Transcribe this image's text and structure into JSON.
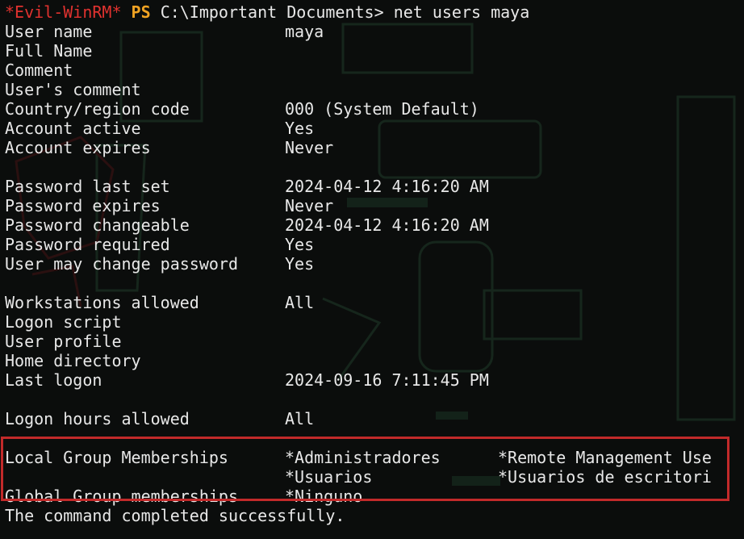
{
  "prompt": {
    "shell_tag": "*Evil-WinRM*",
    "ps": "PS",
    "path": "C:\\Important Documents>",
    "command": "net users maya"
  },
  "rows": [
    {
      "label": "User name",
      "value": "maya"
    },
    {
      "label": "Full Name",
      "value": ""
    },
    {
      "label": "Comment",
      "value": ""
    },
    {
      "label": "User's comment",
      "value": ""
    },
    {
      "label": "Country/region code",
      "value": "000 (System Default)"
    },
    {
      "label": "Account active",
      "value": "Yes"
    },
    {
      "label": "Account expires",
      "value": "Never"
    },
    {
      "label": "Password last set",
      "value": "2024-04-12 4:16:20 AM"
    },
    {
      "label": "Password expires",
      "value": "Never"
    },
    {
      "label": "Password changeable",
      "value": "2024-04-12 4:16:20 AM"
    },
    {
      "label": "Password required",
      "value": "Yes"
    },
    {
      "label": "User may change password",
      "value": "Yes"
    },
    {
      "label": "Workstations allowed",
      "value": "All"
    },
    {
      "label": "Logon script",
      "value": ""
    },
    {
      "label": "User profile",
      "value": ""
    },
    {
      "label": "Home directory",
      "value": ""
    },
    {
      "label": "Last logon",
      "value": "2024-09-16 7:11:45 PM"
    },
    {
      "label": "Logon hours allowed",
      "value": "All"
    }
  ],
  "groups": {
    "local_label": "Local Group Memberships",
    "local_1": "*Administradores",
    "local_2": "*Remote Management Use",
    "local_3": "*Usuarios",
    "local_4": "*Usuarios de escritori",
    "global_label": "Global Group memberships",
    "global_1": "*Ninguno"
  },
  "footer": "The command completed successfully.",
  "colors": {
    "background": "#0b0d0c",
    "text": "#e8e8e8",
    "evil_tag": "#e0322f",
    "ps_tag": "#f0a323",
    "highlight_box": "#c22a2a"
  }
}
